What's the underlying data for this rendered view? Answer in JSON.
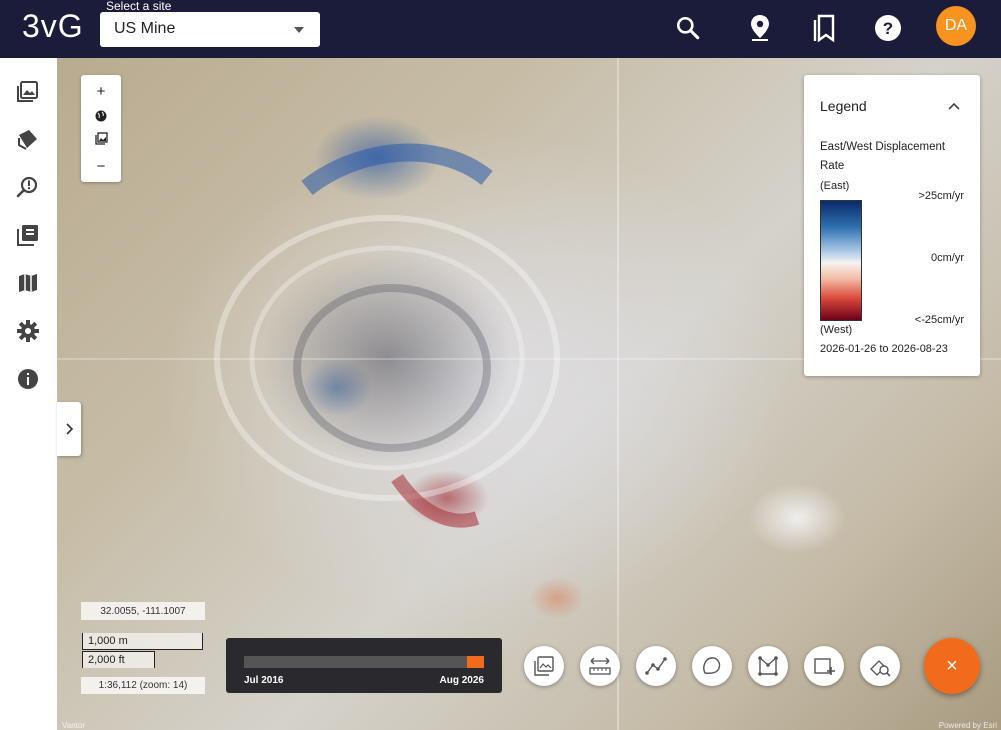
{
  "app": {
    "logo": "3vG",
    "site_label": "Select a site",
    "site_value": "US Mine",
    "avatar_initials": "DA"
  },
  "topbar_icons": [
    "search-icon",
    "location-pin-icon",
    "bookmarks-icon",
    "help-icon"
  ],
  "sidebar_icons": [
    "imagery-icon",
    "layers-icon",
    "alerts-search-icon",
    "collections-icon",
    "map-icon",
    "settings-icon",
    "info-icon"
  ],
  "zoom": {
    "in_label": "+",
    "out_label": "−"
  },
  "legend": {
    "title": "Legend",
    "description": "East/West Displacement Rate",
    "east_label": "(East)",
    "west_label": "(West)",
    "ticks": [
      ">25cm/yr",
      "0cm/yr",
      "<-25cm/yr"
    ],
    "date_range": "2026-01-26 to 2026-08-23",
    "colors": [
      "#0a2a6a",
      "#2f6fb0",
      "#a9c9e6",
      "#f7f2f0",
      "#f2b7a0",
      "#d9473a",
      "#6d0019"
    ]
  },
  "map_info": {
    "coordinates": "32.0055, -111.1007",
    "scale_metric": "1,000 m",
    "scale_imperial": "2,000 ft",
    "zoom_text": "1:36,112 (zoom: 14)"
  },
  "timeline": {
    "start_label": "Jul 2016",
    "end_label": "Aug 2026",
    "selection_start": 0.93,
    "selection_end": 1.0
  },
  "tools": [
    "imagery-tool-icon",
    "measure-distance-icon",
    "line-tool-icon",
    "polygon-freehand-icon",
    "polygon-tool-icon",
    "add-rectangle-icon",
    "analysis-search-icon"
  ],
  "fab_label": "×",
  "attribution": {
    "left": "Vantor",
    "right": "Powered by Esri"
  }
}
